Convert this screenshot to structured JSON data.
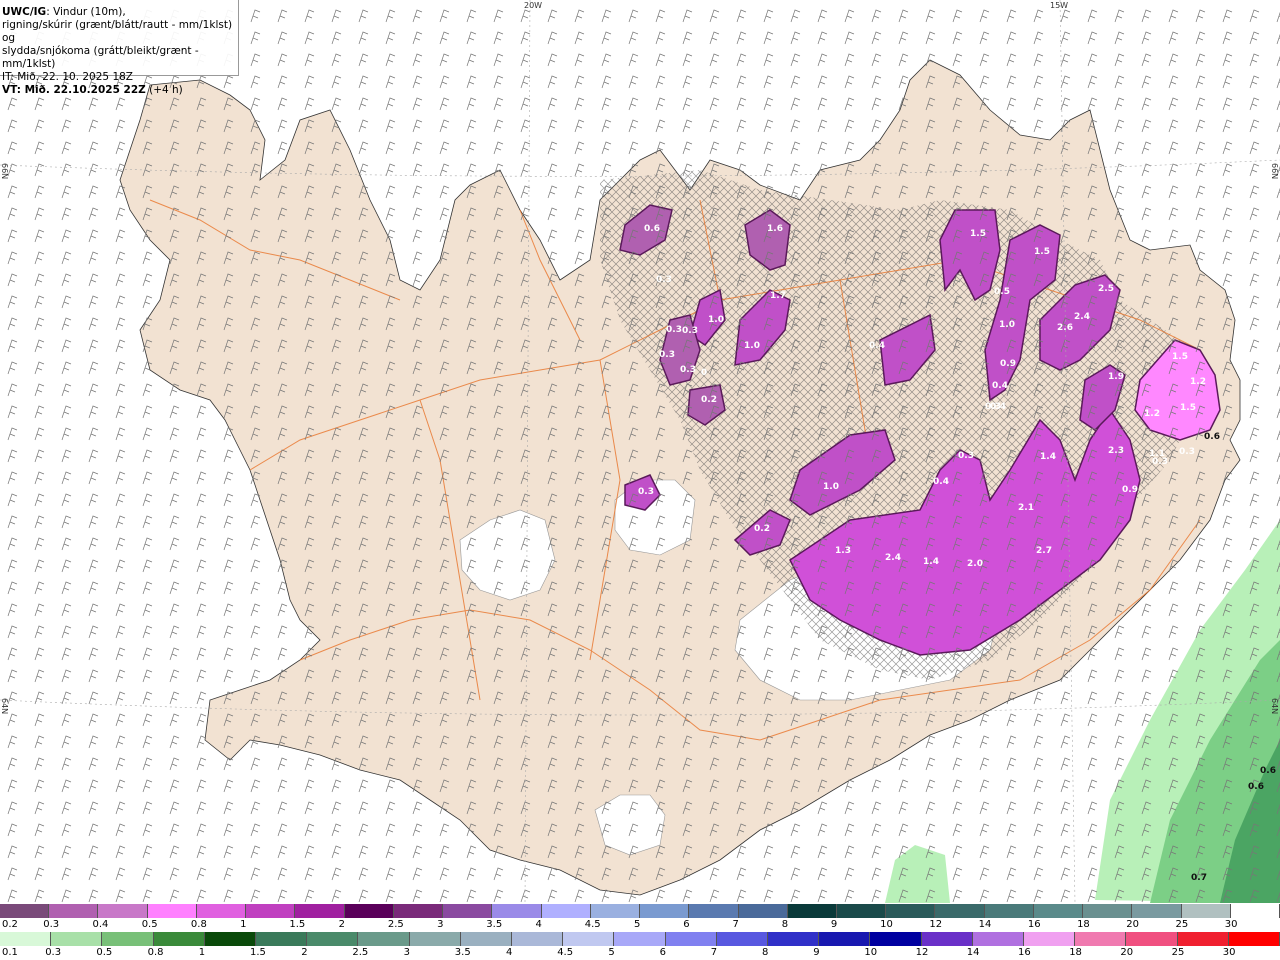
{
  "title": {
    "product": "UWC/IG",
    "line1_rest": ": Vindur (10m),",
    "line2": "rigning/skúrir (grænt/blátt/rautt - mm/1klst) og",
    "line3": "slydda/snjókoma (grátt/bleikt/grænt - mm/1klst)",
    "it": "IT: Mið. 22. 10. 2025 18Z",
    "vt_prefix": "VT: Mið. 22.10.2025 22Z",
    "vt_suffix": " (+4 h)"
  },
  "graticule": {
    "lon_20": "20W",
    "lon_15": "15W",
    "lat_66_left": "66N",
    "lat_66_right": "66N",
    "lat_64_left": "64N",
    "lat_64_right": "64N"
  },
  "colors": {
    "sea": "#ffffff",
    "land": "#f2e2d2",
    "glacier": "#ffffff",
    "roads": "#e8742a",
    "rain_light": "#b8f0b8",
    "rain_mid": "#7ccf86",
    "rain_dark": "#3f9a5a",
    "snow_light": "#ff88ff",
    "snow_mid": "#d050d8",
    "snow_dark": "#5a1a5a"
  },
  "precip_values": [
    "0.6",
    "1.6",
    "1.5",
    "1.5",
    "0.3",
    "1.7",
    "1.0",
    "0.3",
    "0.3",
    "1.0",
    "0.3",
    "0.3",
    "0",
    "0.2",
    "0.5",
    "2.5",
    "2.4",
    "2.6",
    "0.4",
    "1.0",
    "0.9",
    "0.4",
    "0.4",
    "0.3",
    "1.9",
    "1.5",
    "1.2",
    "1.5",
    "1.2",
    "0.6",
    "0.3",
    "0.3",
    "2.3",
    "0.9",
    "1.1",
    "1.0",
    "0.3",
    "0.4",
    "1.4",
    "2.1",
    "0.3",
    "0.2",
    "1.3",
    "2.4",
    "1.4",
    "2.0",
    "2.7"
  ],
  "rain_values": [
    "0.6",
    "0.6",
    "0.7"
  ],
  "colorbar_snow": {
    "labels": [
      "0.2",
      "0.3",
      "0.4",
      "0.5",
      "0.8",
      "1",
      "1.5",
      "2",
      "2.5",
      "3",
      "3.5",
      "4",
      "4.5",
      "5",
      "6",
      "7",
      "8",
      "9",
      "10",
      "12",
      "14",
      "16",
      "18",
      "20",
      "25",
      "30"
    ],
    "colors": [
      "#7a4a7a",
      "#b060b0",
      "#c878c8",
      "#ff80ff",
      "#e060e0",
      "#c040c0",
      "#a020a0",
      "#5a005a",
      "#7a2a7a",
      "#8a4aa0",
      "#9a8ae8",
      "#b0b0ff",
      "#9ab0e0",
      "#7a9ad0",
      "#5a7ab0",
      "#4a6a9a",
      "#0a3a3a",
      "#1a4a4a",
      "#2a5a5a",
      "#3a6a6a",
      "#4a7a7a",
      "#5a8a8a",
      "#6a9090",
      "#7a9aa0",
      "#b0c0c0",
      "#ffffff"
    ]
  },
  "colorbar_rain": {
    "labels": [
      "0.1",
      "0.3",
      "0.5",
      "0.8",
      "1",
      "1.5",
      "2",
      "2.5",
      "3",
      "3.5",
      "4",
      "4.5",
      "5",
      "6",
      "7",
      "8",
      "9",
      "10",
      "12",
      "14",
      "16",
      "18",
      "20",
      "25",
      "30"
    ],
    "colors": [
      "#d8f8d8",
      "#a8e0a8",
      "#78c078",
      "#3a8a3a",
      "#0a4a0a",
      "#3a7a5a",
      "#4a8a6a",
      "#6a9a8a",
      "#8aaaaa",
      "#9ab0c0",
      "#aab8d8",
      "#c0c8f0",
      "#a8a8f8",
      "#8080f0",
      "#5858e0",
      "#3030c8",
      "#1818b0",
      "#0000a0",
      "#6a30c8",
      "#b070e0",
      "#f0a0f0",
      "#f07ab0",
      "#f05080",
      "#f02030",
      "#ff0000"
    ]
  }
}
